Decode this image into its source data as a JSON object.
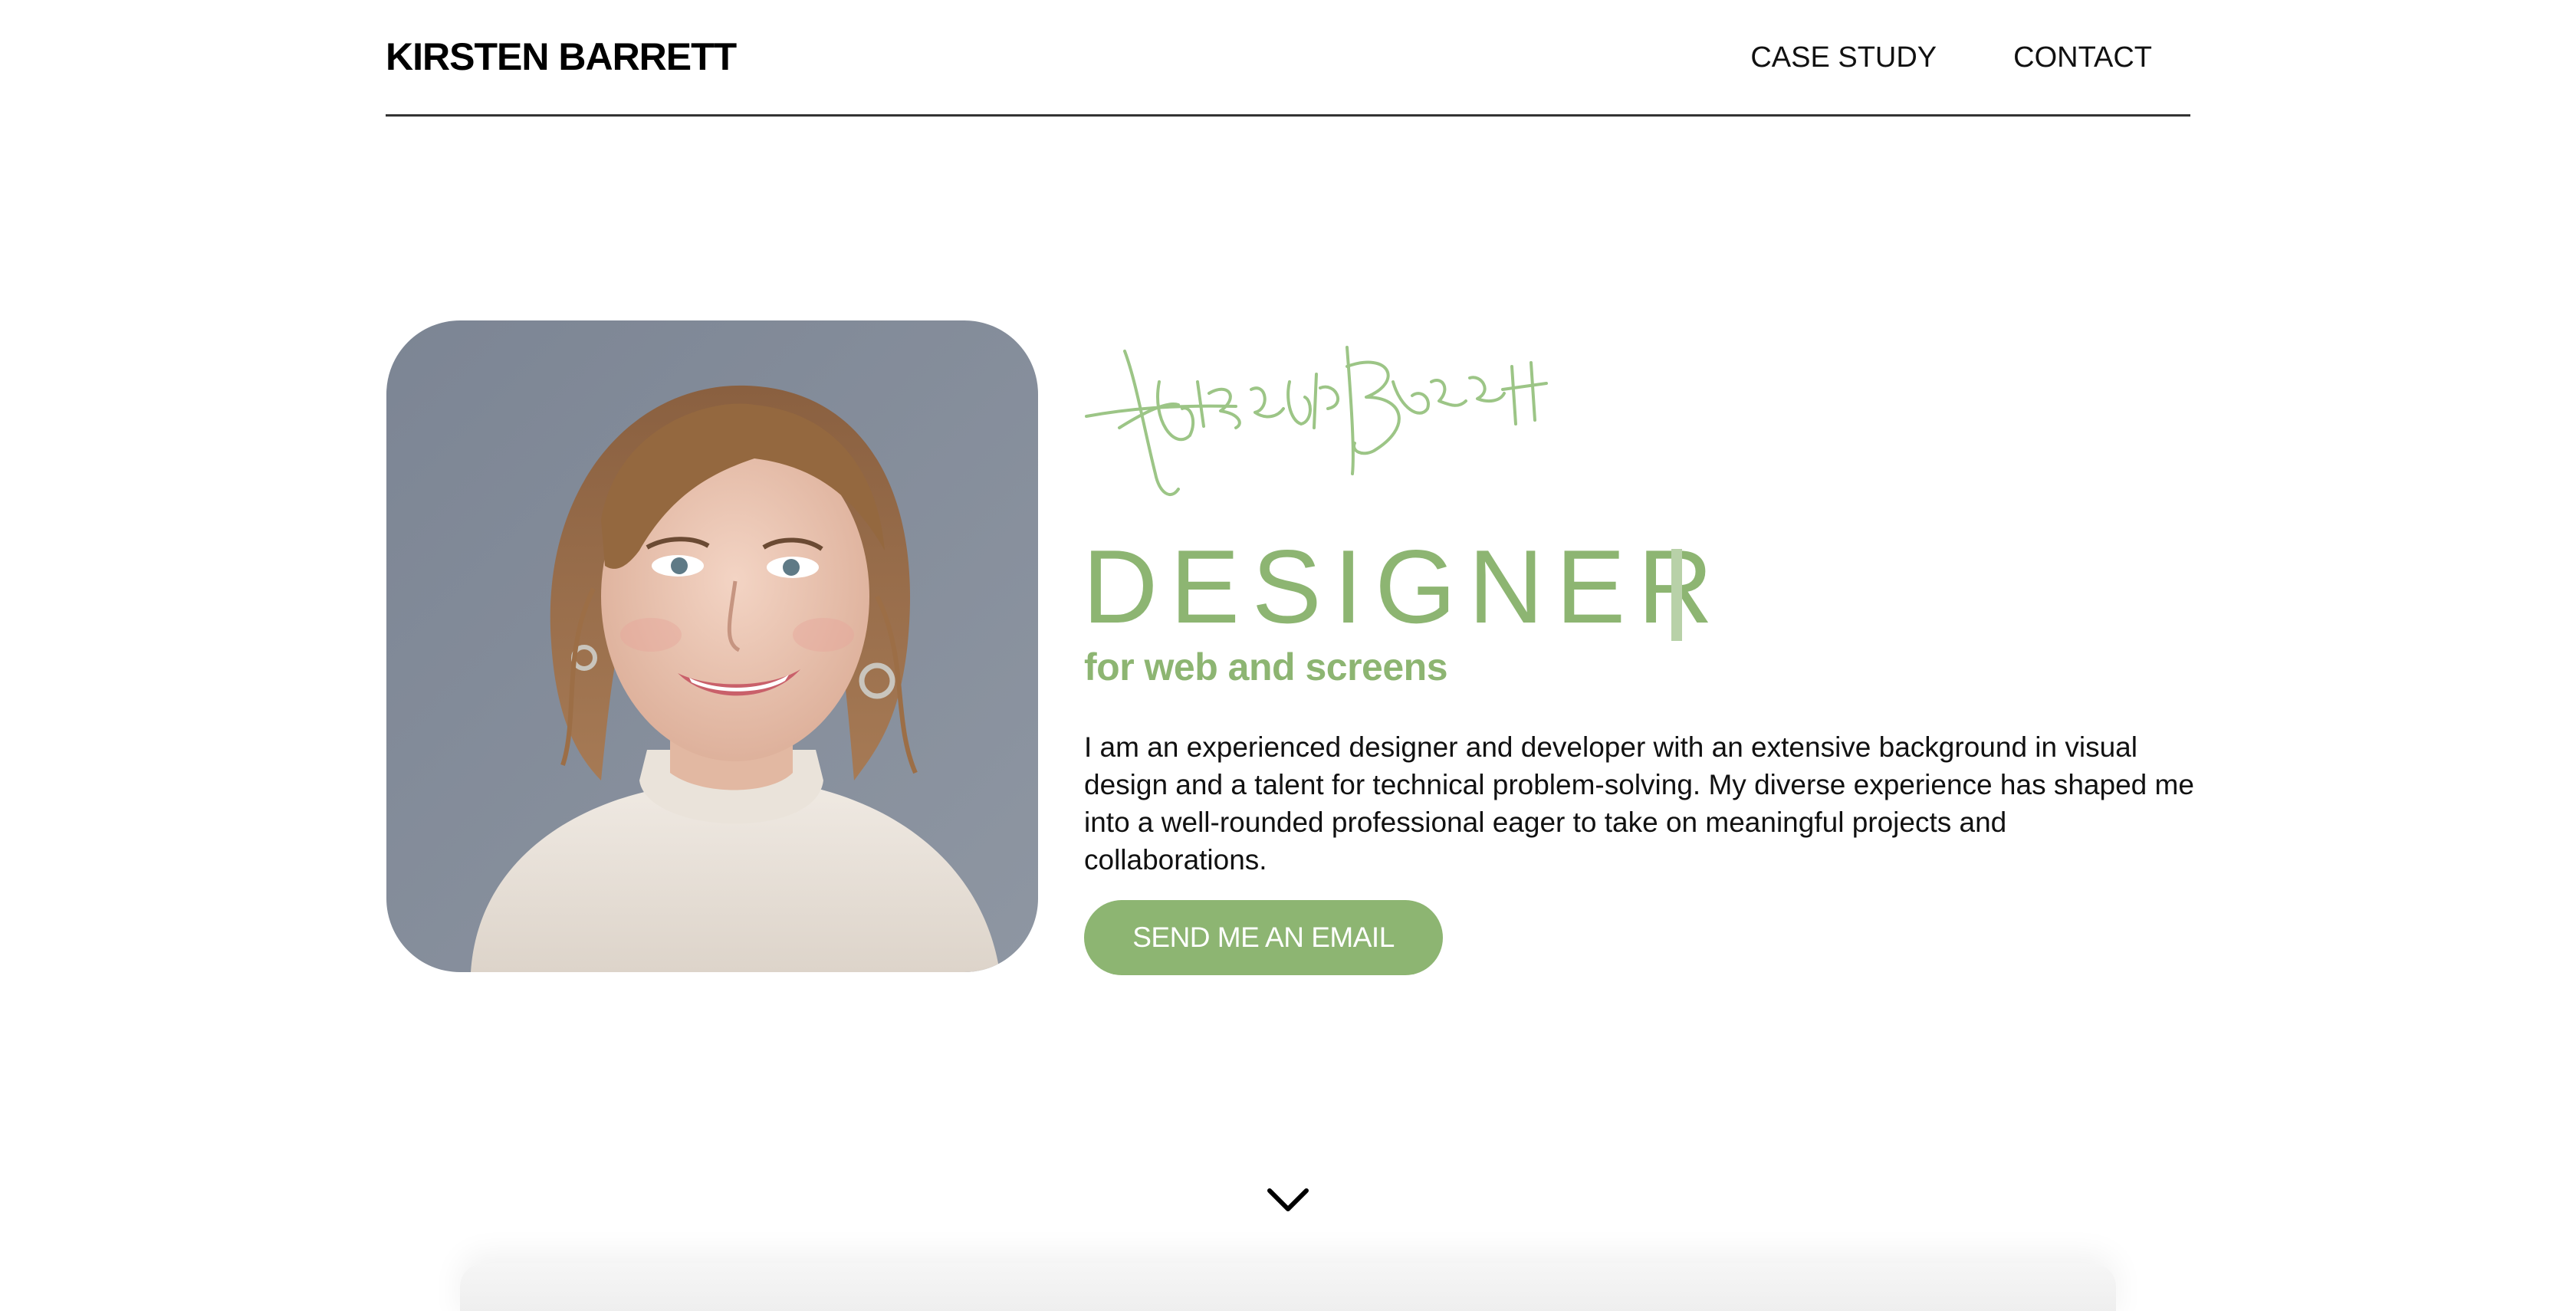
{
  "header": {
    "brand": "KIRSTEN BARRETT",
    "nav": [
      {
        "label": "CASE STUDY"
      },
      {
        "label": "CONTACT"
      }
    ]
  },
  "hero": {
    "signature_text": "Kirsten Barrett",
    "headline": "DESIGNER",
    "subheadline": "for web and screens",
    "bio": "I am an experienced designer and developer with an extensive background in visual design and a talent for technical problem-solving. My diverse experience has shaped me into a well-rounded professional eager to take on meaningful projects and collaborations.",
    "cta_label": "SEND ME AN EMAIL",
    "scroll_icon": "chevron-down-icon"
  },
  "colors": {
    "accent": "#8db572",
    "text": "#111111",
    "divider": "#333333",
    "background": "#ffffff"
  }
}
